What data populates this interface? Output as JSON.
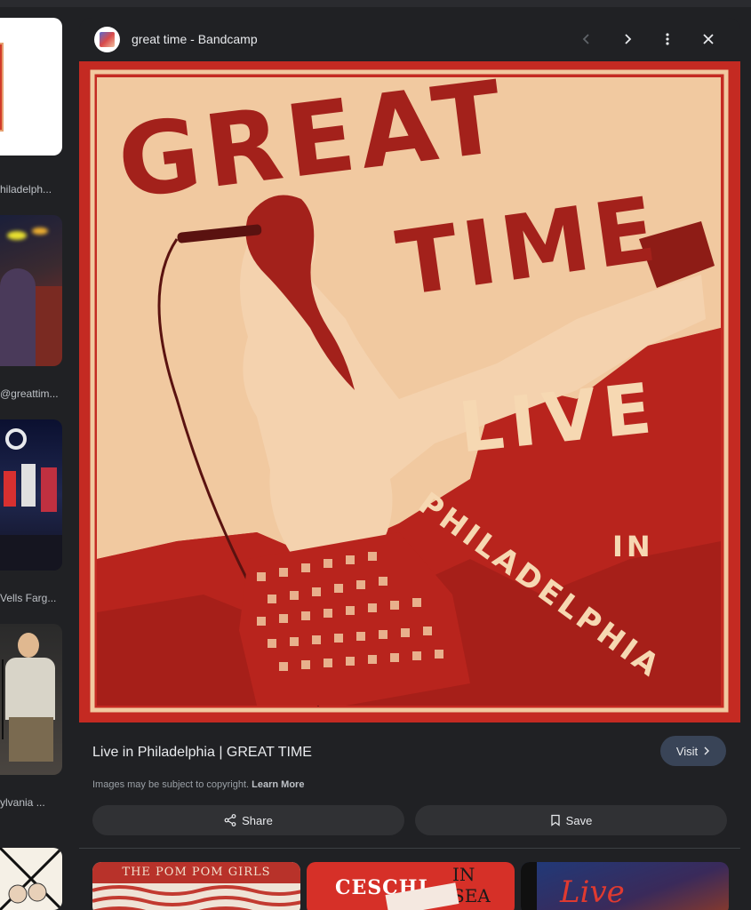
{
  "panel": {
    "site_title": "great time - Bandcamp",
    "image_title": "Live in Philadelphia | GREAT TIME",
    "visit_label": "Visit",
    "copyright_text": "Images may be subject to copyright.",
    "learn_more_label": "Learn More",
    "share_label": "Share",
    "save_label": "Save"
  },
  "artwork": {
    "headline_line1": "GREAT",
    "headline_line2": "TIME",
    "live_word": "LIVE",
    "in_word": "IN",
    "city_word": "PHILADELPHIA",
    "colors": {
      "red": "#c42a22",
      "paper": "#f1c9a0",
      "dark_red": "#8e1c16"
    }
  },
  "left_results": {
    "captions": [
      "hiladelph...",
      "@greattim...",
      "Vells Farg...",
      "ylvania ..."
    ]
  },
  "related": {
    "item1_text": "THE POM POM GIRLS",
    "item2_text": "CESCHI",
    "item2_text_b": "IN SEA",
    "item3_text": "Live"
  },
  "icons": {
    "prev": "chevron-left-icon",
    "next": "chevron-right-icon",
    "more": "more-vert-icon",
    "close": "close-icon",
    "share": "share-icon",
    "save": "bookmark-icon"
  }
}
